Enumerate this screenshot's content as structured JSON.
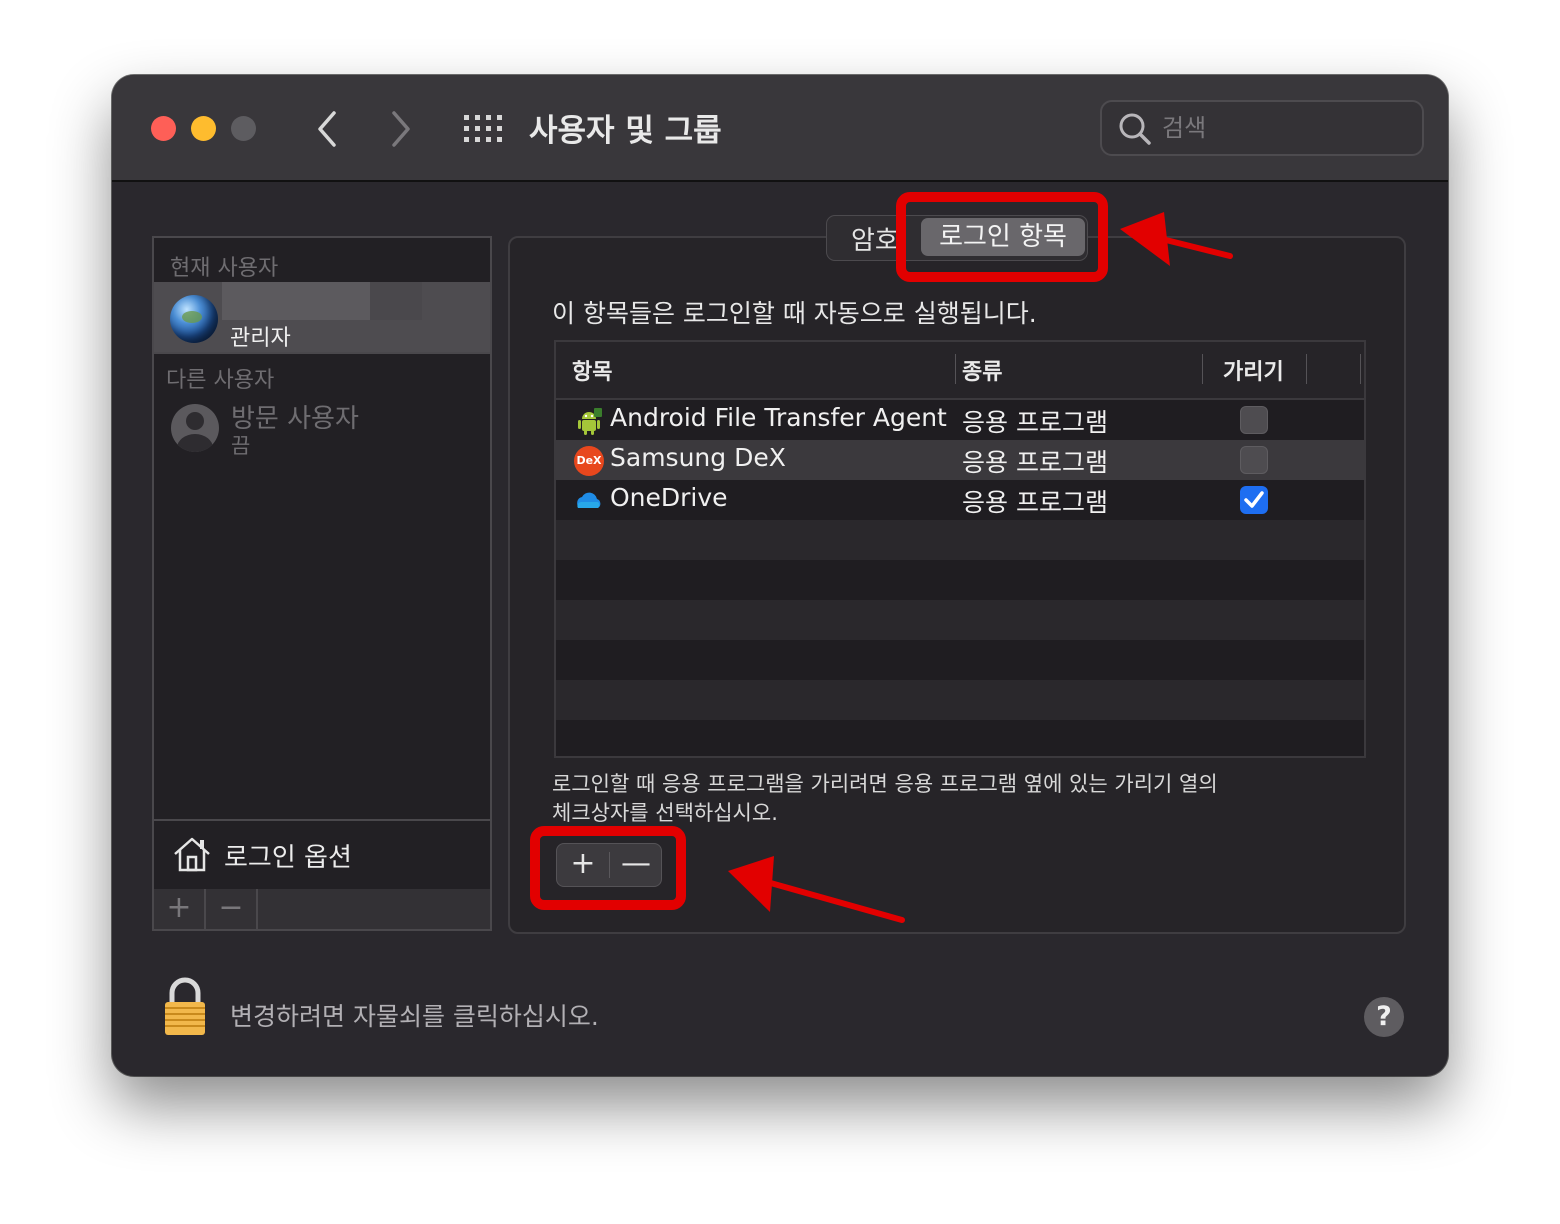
{
  "window": {
    "title": "사용자 및 그룹",
    "search_placeholder": "검색"
  },
  "sidebar": {
    "current_users_label": "현재 사용자",
    "current_user_role": "관리자",
    "other_users_label": "다른 사용자",
    "guest_name": "방문 사용자",
    "guest_status": "끔",
    "login_options_label": "로그인 옵션",
    "add_label": "+",
    "remove_label": "−"
  },
  "tabs": {
    "password": "암호",
    "login_items": "로그인 항목"
  },
  "panel": {
    "description": "이 항목들은 로그인할 때 자동으로 실행됩니다.",
    "hint_line1": "로그인할 때 응용 프로그램을 가리려면 응용 프로그램 옆에 있는 가리기 열의",
    "hint_line2": "체크상자를 선택하십시오.",
    "add_label": "+",
    "remove_label": "—"
  },
  "table": {
    "columns": [
      "항목",
      "종류",
      "가리기"
    ],
    "rows": [
      {
        "name": "Android File Transfer Agent",
        "kind": "응용 프로그램",
        "hide": false,
        "icon": "android-icon"
      },
      {
        "name": "Samsung DeX",
        "kind": "응용 프로그램",
        "hide": false,
        "icon": "dex-icon",
        "icon_text": "DeX"
      },
      {
        "name": "OneDrive",
        "kind": "응용 프로그램",
        "hide": true,
        "icon": "onedrive-cloud-icon"
      }
    ]
  },
  "footer": {
    "lock_text": "변경하려면 자물쇠를 클릭하십시오.",
    "help_label": "?"
  },
  "colors": {
    "annotation_red": "#e20000",
    "checkbox_blue": "#1e6ef1",
    "window_bg": "#2a282d"
  }
}
